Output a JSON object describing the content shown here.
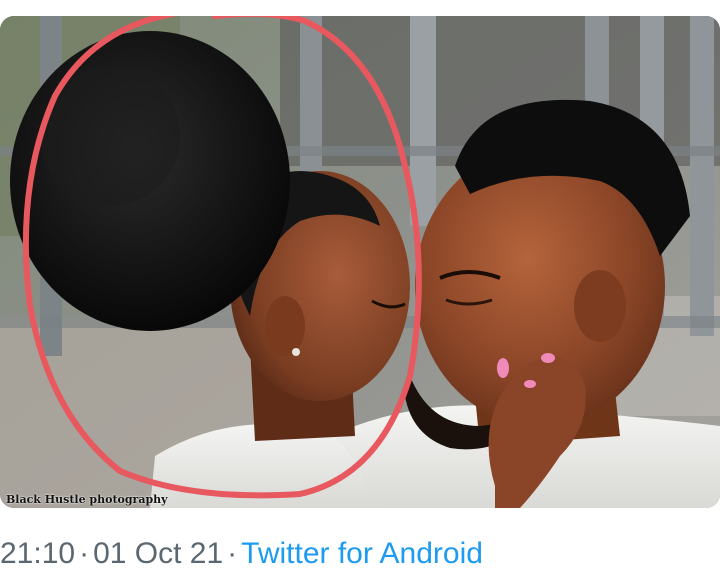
{
  "tweet": {
    "photo": {
      "description_icon": "photo-icon",
      "watermark": "Black Hustle photography",
      "annotation_color": "#e8585f"
    },
    "meta": {
      "time": "21:10",
      "separator": "·",
      "date": "01 Oct 21",
      "source": "Twitter for Android"
    },
    "colors": {
      "meta_text": "#5b6770",
      "link": "#1d9bf0"
    }
  }
}
